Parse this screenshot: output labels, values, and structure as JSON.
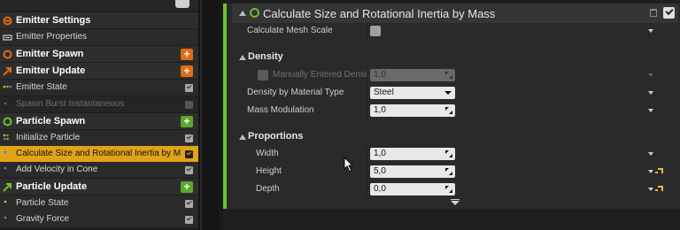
{
  "stack": {
    "rows": [
      {
        "kind": "group",
        "label": "Emitter Settings",
        "icon": "emitter-settings-icon",
        "color": "#e36b14"
      },
      {
        "kind": "item",
        "label": "Emitter Properties",
        "icon": "cpu-icon"
      },
      {
        "kind": "group",
        "label": "Emitter Spawn",
        "icon": "spawn-ring-icon",
        "color": "#e36b14",
        "add": "+"
      },
      {
        "kind": "group",
        "label": "Emitter Update",
        "icon": "update-arrow-icon",
        "color": "#e36b14",
        "add": "+"
      },
      {
        "kind": "item",
        "label": "Emitter State",
        "icon": "state-dots-icon",
        "checked": true
      },
      {
        "kind": "item",
        "label": "Spawn Burst Instantaneous",
        "icon": "burst-icon",
        "checked": false,
        "disabled": true
      },
      {
        "kind": "group",
        "label": "Particle Spawn",
        "icon": "spawn-ring-icon",
        "color": "#59a82b",
        "add": "+"
      },
      {
        "kind": "item",
        "label": "Initialize Particle",
        "icon": "init-grid-icon",
        "checked": true
      },
      {
        "kind": "item",
        "label": "Calculate Size and Rotational Inertia by M",
        "icon": "calc-dot-icon",
        "checked": true,
        "selected": true
      },
      {
        "kind": "item",
        "label": "Add Velocity in Cone",
        "icon": "velocity-dot-icon",
        "checked": true
      },
      {
        "kind": "group",
        "label": "Particle Update",
        "icon": "update-arrow-icon",
        "color": "#59a82b",
        "add": "+"
      },
      {
        "kind": "item",
        "label": "Particle State",
        "icon": "state-dots-icon",
        "checked": true
      },
      {
        "kind": "item",
        "label": "Gravity Force",
        "icon": "gravity-dot-icon",
        "checked": true
      }
    ]
  },
  "details": {
    "title": "Calculate Size and Rotational Inertia by Mass",
    "calc_mesh_scale": {
      "label": "Calculate Mesh Scale"
    },
    "density": {
      "category": "Density",
      "manual": {
        "label": "Manually Entered Densi",
        "value": "1,0"
      },
      "by_material": {
        "label": "Density by Material Type",
        "value": "Steel"
      },
      "modulation": {
        "label": "Mass Modulation",
        "value": "1,0"
      }
    },
    "proportions": {
      "category": "Proportions",
      "width": {
        "label": "Width",
        "value": "1,0"
      },
      "height": {
        "label": "Height",
        "value": "5,0"
      },
      "depth": {
        "label": "Depth",
        "value": "0,0"
      }
    }
  },
  "colors": {
    "selected": "#e2a31a",
    "spawn_orange": "#e36b14",
    "particle_green": "#59a82b",
    "module_bar": "#6fc32a",
    "reset": "#e6c229"
  }
}
